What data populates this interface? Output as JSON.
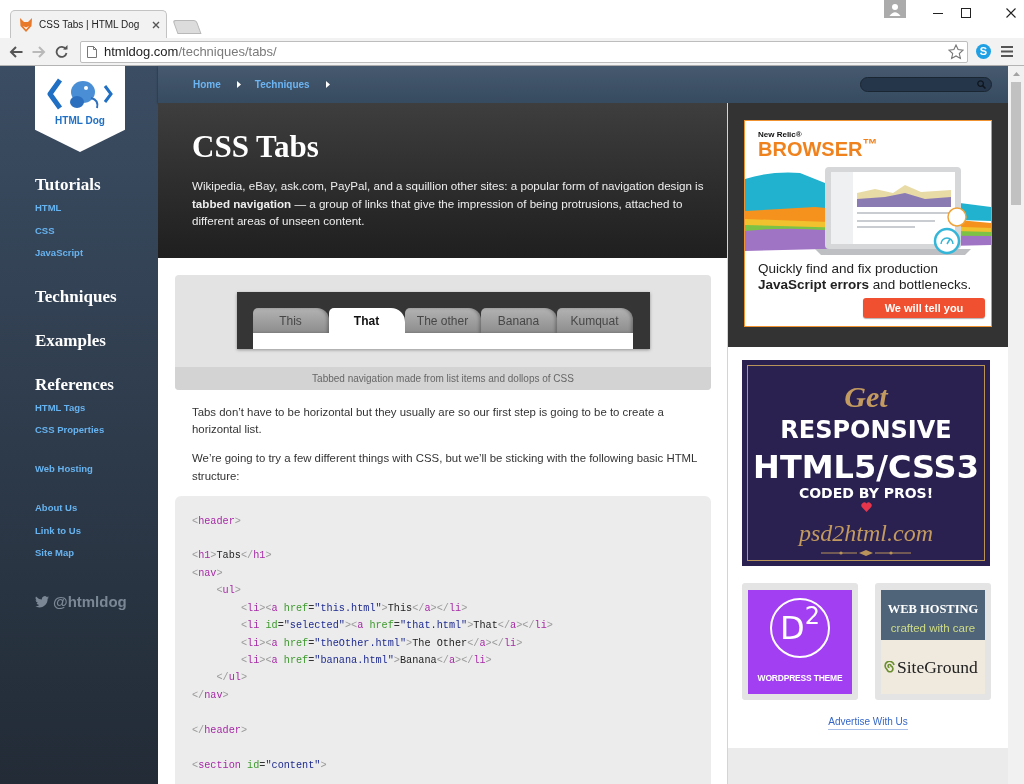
{
  "browser": {
    "tab_title": "CSS Tabs | HTML Dog",
    "url_host": "htmldog.com",
    "url_path": "/techniques/tabs/",
    "extension_label": "S"
  },
  "sidebar": {
    "logo_text": "HTML Dog",
    "sections": [
      {
        "heading": "Tutorials",
        "links": [
          "HTML",
          "CSS",
          "JavaScript"
        ]
      },
      {
        "heading": "Techniques"
      },
      {
        "heading": "Examples"
      },
      {
        "heading": "References",
        "links": [
          "HTML Tags",
          "CSS Properties"
        ]
      }
    ],
    "link_groups": [
      [
        "Web Hosting"
      ],
      [
        "About Us",
        "Link to Us",
        "Site Map"
      ]
    ],
    "twitter": "@htmldog"
  },
  "breadcrumb": [
    "Home",
    "Techniques"
  ],
  "header": {
    "title": "CSS Tabs",
    "intro": "Wikipedia, eBay, ask.com, PayPal, and a squillion other sites: a popular form of navigation design is **tabbed navigation** — a group of links that give the impression of being protrusions, attached to different areas of unseen content."
  },
  "figure": {
    "tabs": [
      {
        "label": "This",
        "selected": false
      },
      {
        "label": "That",
        "selected": true
      },
      {
        "label": "The other",
        "selected": false
      },
      {
        "label": "Banana",
        "selected": false
      },
      {
        "label": "Kumquat",
        "selected": false
      }
    ],
    "caption": "Tabbed navigation made from list items and dollops of CSS"
  },
  "paragraphs": [
    "Tabs don’t have to be horizontal but they usually are so our first step is going to be to create a horizontal list.",
    "We’re going to try a few different things with CSS, but we’ll be sticking with the following basic HTML structure:"
  ],
  "code_blocks": [
    [
      "<header>"
    ],
    [
      "<h1>Tabs</h1>",
      "<nav>",
      "    <ul>",
      "        <li><a href=\"this.html\">This</a></li>",
      "        <li id=\"selected\"><a href=\"that.html\">That</a></li>",
      "        <li><a href=\"theOther.html\">The Other</a></li>",
      "        <li><a href=\"banana.html\">Banana</a></li>",
      "    </ul>",
      "</nav>"
    ],
    [
      "</header>"
    ],
    [
      "<section id=\"content\">"
    ]
  ],
  "sponsor_ad": {
    "brand": "New Relic®",
    "product": "BROWSER$^{™}$",
    "text": "Quickly find and fix production **JavaScript errors** and bottlenecks.",
    "button": "We will tell you"
  },
  "banner_ad": {
    "kicker": "Get",
    "headline": "RESPONSIVE",
    "title": "HTML5/CSS3",
    "tagline": "CODED BY PROS!",
    "site": "psd2html.com"
  },
  "small_ads": [
    {
      "kind": "theme",
      "logo": "D$^{2}$",
      "label": "WORDPRESS THEME"
    },
    {
      "kind": "hosting",
      "title": "WEB HOSTING",
      "subtitle": "crafted with care",
      "brand": "SiteGround"
    }
  ],
  "advertise_link": "Advertise With Us"
}
